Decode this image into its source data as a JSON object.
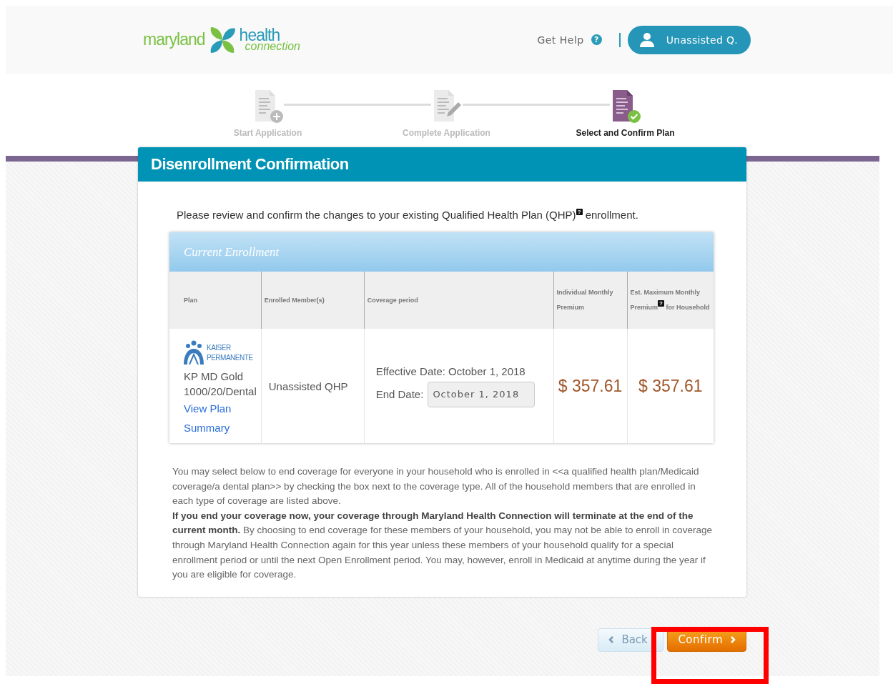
{
  "header": {
    "logo": {
      "word_1": "maryland",
      "word_2": "health",
      "word_3": "connection"
    },
    "get_help": "Get Help",
    "help_glyph": "?",
    "user_button": "Unassisted Q."
  },
  "steps": [
    {
      "label": "Start Application",
      "kind": "plus",
      "selected": false
    },
    {
      "label": "Complete Application",
      "kind": "pencil",
      "selected": false
    },
    {
      "label": "Select and Confirm Plan",
      "kind": "check",
      "selected": true
    }
  ],
  "card": {
    "title": "Disenrollment Confirmation",
    "intro": "Please review and confirm the changes to your existing Qualified Health Plan (QHP)$^{?}$ enrollment.",
    "enrollment": {
      "title": "Current Enrollment",
      "columns": [
        "Plan",
        "Enrolled Member(s)",
        "Coverage period",
        "Individual Monthly Premium",
        "Est. Maximum Monthly Premium$^{?}$ for Household"
      ],
      "rows": [
        {
          "logo_lines": [
            "KAISER",
            "PERMANENTE"
          ],
          "plan": "KP MD Gold 1000/20/Dental",
          "plan_link": "View Plan Summary",
          "members": "Unassisted QHP",
          "effective_label": "Effective Date:",
          "effective_value": "October 1, 2018",
          "end_label": "End Date:",
          "end_value": "October 1, 2018",
          "individual_premium": "$ 357.61",
          "household_premium": "$ 357.61"
        }
      ]
    },
    "paragraphs": [
      "You may select below to end coverage for everyone in your household who is enrolled in <<a qualified health plan/Medicaid coverage/a dental plan>> by checking the box next to the coverage type. All of the household members that are enrolled in each type of coverage are listed above.",
      "**If you end your coverage now, your coverage through Maryland Health Connection will terminate at the end of the current month.** By choosing to end coverage for these members of your household, you may not be able to enroll in coverage through Maryland Health Connection again for this year unless these members of your household qualify for a special enrollment period or until the next Open Enrollment period. You may, however, enroll in Medicaid at anytime during the year if you are eligible for coverage."
    ]
  },
  "buttons": {
    "back": "Back",
    "confirm": "Confirm"
  }
}
